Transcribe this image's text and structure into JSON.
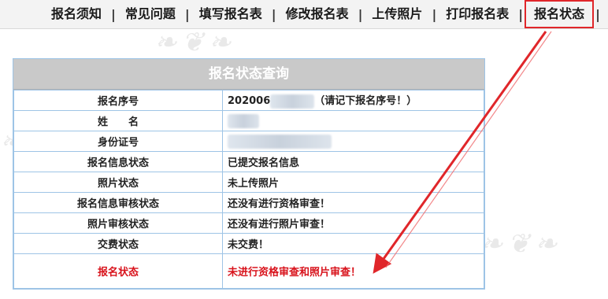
{
  "nav": {
    "items": [
      {
        "label": "报名须知"
      },
      {
        "label": "常见问题"
      },
      {
        "label": "填写报名表"
      },
      {
        "label": "修改报名表"
      },
      {
        "label": "上传照片"
      },
      {
        "label": "打印报名表"
      },
      {
        "label": "报名状态"
      }
    ],
    "active_index": 6,
    "separator": "|"
  },
  "panel": {
    "title": "报名状态查询",
    "rows": [
      {
        "label": "报名序号",
        "value_prefix": "202006",
        "value_note": "（请记下报名序号！）"
      },
      {
        "label": "姓　　名",
        "value": ""
      },
      {
        "label": "身份证号",
        "value": ""
      },
      {
        "label": "报名信息状态",
        "value": "已提交报名信息"
      },
      {
        "label": "照片状态",
        "value": "未上传照片"
      },
      {
        "label": "报名信息审核状态",
        "value": "还没有进行资格审查！"
      },
      {
        "label": "照片审核状态",
        "value": "还没有进行照片审查！"
      },
      {
        "label": "交费状态",
        "value": "未交费！"
      },
      {
        "label": "报名状态",
        "value": "未进行资格审查和照片审查！"
      }
    ]
  },
  "colors": {
    "highlight": "#e0262a",
    "status_text": "#d8121b",
    "header_bg": "#c9c9c9",
    "border": "#9ec4e6"
  }
}
